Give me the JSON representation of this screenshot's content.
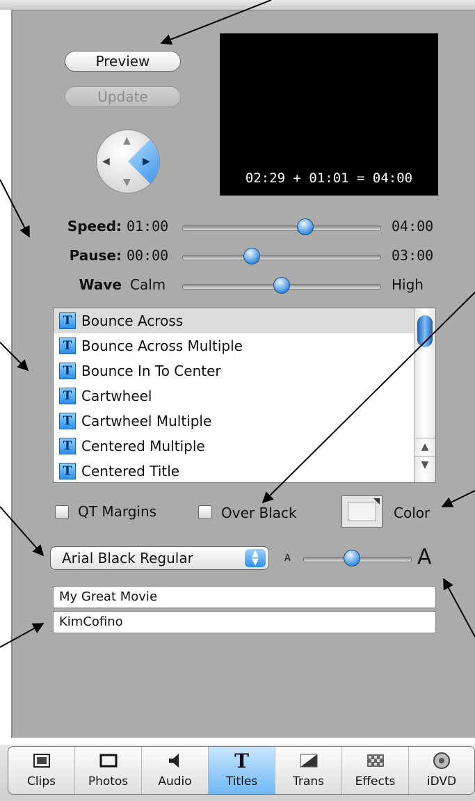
{
  "preview": {
    "button_label": "Preview",
    "update_label": "Update",
    "timecode": "02:29 + 01:01 = 04:00"
  },
  "sliders": [
    {
      "label": "Speed:",
      "min": "01:00",
      "max": "04:00",
      "value": 0.62
    },
    {
      "label": "Pause:",
      "min": "00:00",
      "max": "03:00",
      "value": 0.35
    },
    {
      "label": "Wave",
      "min": "Calm",
      "max": "High",
      "value": 0.5
    }
  ],
  "titles_list": {
    "items": [
      "Bounce Across",
      "Bounce Across Multiple",
      "Bounce In To Center",
      "Cartwheel",
      "Cartwheel Multiple",
      "Centered Multiple",
      "Centered Title"
    ],
    "selected_index": 0,
    "icon_glyph": "T"
  },
  "options": {
    "qt_margins": "QT Margins",
    "over_black": "Over Black",
    "color": "Color"
  },
  "font": {
    "selected": "Arial Black Regular",
    "size_small": "A",
    "size_large": "A",
    "size_value": 0.45
  },
  "text_fields": {
    "line1": "My Great Movie",
    "line2": "KimCofino"
  },
  "tabs": [
    {
      "label": "Clips",
      "icon": "clips-icon"
    },
    {
      "label": "Photos",
      "icon": "photos-icon"
    },
    {
      "label": "Audio",
      "icon": "audio-icon"
    },
    {
      "label": "Titles",
      "icon": "titles-icon"
    },
    {
      "label": "Trans",
      "icon": "trans-icon"
    },
    {
      "label": "Effects",
      "icon": "effects-icon"
    },
    {
      "label": "iDVD",
      "icon": "idvd-icon"
    }
  ],
  "active_tab": 3,
  "colors": {
    "panel": "#ababab",
    "accent_blue": "#2d8ee8",
    "screen": "#000000"
  }
}
